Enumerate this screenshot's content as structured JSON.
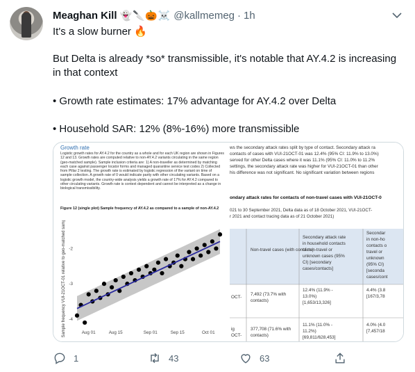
{
  "tweet": {
    "author_name": "Meaghan Kill",
    "author_emojis": "👻🔪🎃☠️",
    "handle": "@kallmemeg",
    "separator": "·",
    "time": "1h",
    "line1": "It's a slow burner 🔥",
    "line2": "But Delta is already *so* transmissible, it's notable that AY.4.2 is increasing in that context",
    "line3": "• Growth rate estimates:  17% advantage for AY.4.2 over Delta",
    "line4": "• Household SAR: 12% (8%-16%) more transmissible"
  },
  "media": {
    "left_doc": {
      "section_title": "Growth rate",
      "paragraph": "Logistic growth rates for AY.4.2 for the country as a whole and for each UK region are shown in Figures 12 and 13. Growth rates are computed relative to non-AY.4.2 variants circulating in the same region (geo-matched sample). Sample inclusion criteria are: 1) A non-traveller as determined by matching each case against passenger locator forms and managed quarantine service test codes 2) Collected from Pillar 2 testing. The growth rate is estimated by logistic regression of the variant on time of sample collection. A growth rate of 0 would indicate parity with other circulating variants. Based on a logistic growth model, the country-wide analysis yields a growth rate of 17% for AY.4.2 compared to other circulating variants. Growth rate is context dependent and cannot be interpreted as a change in biological transmissibility.",
      "figure_caption": "Figure 12 (single plot) Sample frequency of AY.4.2 as compared to a sample of non-AY.4.2"
    },
    "right_doc": {
      "text_lines": [
        "ws the secondary attack rates split by type of contact. Secondary attack ra",
        "contacts of cases with VUI-21OCT-01 was 12.4% (95% CI: 11.9% to 13.0%)",
        "served for other Delta cases where it was 11.1% (95% CI: 11.0% to 11.2%",
        "settings, the secondary attack rate was higher for VUI-21OCT-01 than other",
        "his difference was not significant. No significant variation between regions"
      ],
      "heading": "ondary attack rates for contacts of non-travel cases with VUI-21OCT-0",
      "date_lines": [
        "021 to 30 September 2021, Delta data as of 18 October 2021, VUI-21OCT-",
        "r 2021 and contact tracing data as of 21 October 2021)"
      ],
      "table": {
        "col1": "Non-travel cases (with contacts)",
        "col2": [
          "Secondary attack rate",
          "in household contacts",
          "of non-travel or",
          "unknown cases (95%",
          "CI) [secondary",
          "cases/contacts]"
        ],
        "col3": [
          "Secondar",
          "in non-ho",
          "contacts o",
          "travel or",
          "unknown",
          "(95% CI)",
          "[seconda",
          "cases/cont"
        ],
        "rows": [
          {
            "label": "OCT-",
            "cases": [
              "7,492 (73.7% with",
              "contacts)"
            ],
            "sar": [
              "12.4% (11.9% -",
              "13.0%)",
              "[1,653/13,326]"
            ],
            "other": [
              "4.4% (3.8",
              "[167/3,78"
            ]
          },
          {
            "label": "ig",
            "label2": "OCT-",
            "cases": [
              "377,708 (71.6% with",
              "contacts)"
            ],
            "sar": [
              "11.1% (11.0% -",
              "11.2%)",
              "[69,811/628,453]"
            ],
            "other": [
              "4.0% (4.0",
              "[7,457/18"
            ]
          }
        ]
      }
    }
  },
  "chart_data": {
    "type": "scatter",
    "ylabel": "Sample frequency VUI-21OCT-01 relative to geo-matched sample",
    "x_tick_labels": [
      "Aug 01",
      "Aug 15",
      "Sep 01",
      "Sep 15",
      "Oct 01"
    ],
    "y_tick_labels": [
      "-2",
      "-3",
      "-4"
    ],
    "ylim": [
      -4.2,
      -1.4
    ],
    "x": [
      "Jul 25",
      "Jul 27",
      "Jul 29",
      "Jul 31",
      "Aug 02",
      "Aug 04",
      "Aug 06",
      "Aug 08",
      "Aug 10",
      "Aug 12",
      "Aug 14",
      "Aug 16",
      "Aug 18",
      "Aug 20",
      "Aug 22",
      "Aug 24",
      "Aug 26",
      "Aug 28",
      "Aug 30",
      "Sep 01",
      "Sep 03",
      "Sep 05",
      "Sep 07",
      "Sep 09",
      "Sep 11",
      "Sep 13",
      "Sep 15",
      "Sep 17",
      "Sep 19",
      "Sep 21",
      "Sep 23",
      "Sep 25",
      "Sep 27",
      "Sep 29",
      "Oct 01",
      "Oct 03",
      "Oct 05",
      "Oct 07"
    ],
    "points_y": [
      -3.9,
      -3.6,
      -4.1,
      -3.3,
      -3.5,
      -3.2,
      -3.4,
      -3.0,
      -3.3,
      -3.1,
      -2.9,
      -3.2,
      -2.8,
      -3.0,
      -2.7,
      -2.9,
      -2.6,
      -2.8,
      -2.5,
      -2.7,
      -2.6,
      -2.4,
      -2.7,
      -2.3,
      -2.5,
      -2.4,
      -2.2,
      -2.5,
      -2.3,
      -2.1,
      -2.3,
      -2.0,
      -2.2,
      -1.9,
      -2.1,
      -1.8,
      -2.0,
      -1.6
    ],
    "fit_start": -3.7,
    "fit_end": -1.8,
    "band_halfwidth": 0.35
  },
  "actions": {
    "reply_count": "1",
    "retweet_count": "43",
    "like_count": "63"
  },
  "colors": {
    "link": "#2e6fb0",
    "fit_line": "#2a2a9e",
    "band": "#b9b9b9",
    "muted": "#536471"
  }
}
